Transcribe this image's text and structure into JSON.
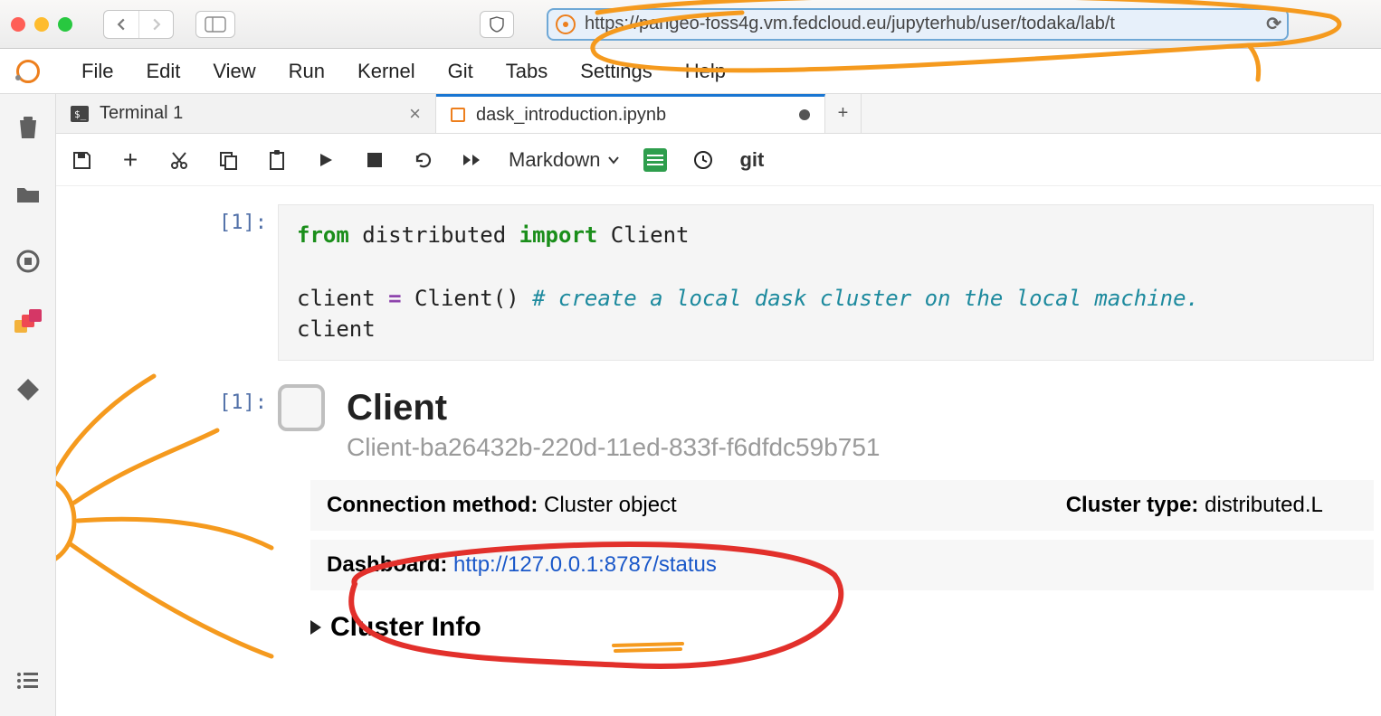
{
  "browser": {
    "url": "https://pangeo-foss4g.vm.fedcloud.eu/jupyterhub/user/todaka/lab/t"
  },
  "menu": {
    "items": [
      "File",
      "Edit",
      "View",
      "Run",
      "Kernel",
      "Git",
      "Tabs",
      "Settings",
      "Help"
    ]
  },
  "tabs": {
    "terminal": "Terminal 1",
    "notebook": "dask_introduction.ipynb"
  },
  "toolbar": {
    "celltype": "Markdown",
    "git": "git"
  },
  "cell_in_prompt": "[1]:",
  "cell_out_prompt": "[1]:",
  "code": {
    "l1a": "from",
    "l1b": " distributed ",
    "l1c": "import",
    "l1d": " Client",
    "l2a": "client ",
    "l2b": "=",
    "l2c": " Client()   ",
    "l2d": "# create a local dask cluster on the local machine.",
    "l3": "client"
  },
  "output": {
    "title": "Client",
    "client_id": "Client-ba26432b-220d-11ed-833f-f6dfdc59b751",
    "conn_label": "Connection method:",
    "conn_val": " Cluster object",
    "type_label": "Cluster type:",
    "type_val": " distributed.L",
    "dash_label": "Dashboard: ",
    "dash_url": "http://127.0.0.1:8787/status",
    "cluster_info": "Cluster Info"
  }
}
